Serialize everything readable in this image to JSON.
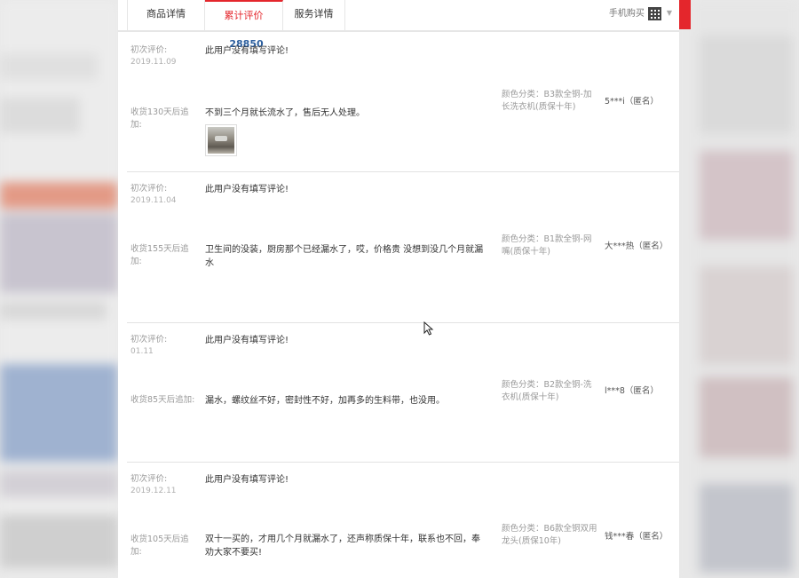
{
  "tabs": [
    {
      "label": "商品详情"
    },
    {
      "label": "累计评价",
      "count": "28850"
    },
    {
      "label": "服务详情"
    }
  ],
  "header": {
    "mobile_buy": "手机购买"
  },
  "reviews": [
    {
      "initial_label": "初次评价:",
      "initial_date": "2019.11.09",
      "initial_text": "此用户没有填写评论!",
      "followup_label": "收货130天后追加:",
      "followup_text": "不到三个月就长流水了，售后无人处理。",
      "sku": "颜色分类：B3款全铜-加长洗衣机(质保十年)",
      "user": "5***i（匿名）"
    },
    {
      "initial_label": "初次评价:",
      "initial_date": "2019.11.04",
      "initial_text": "此用户没有填写评论!",
      "followup_label": "收货155天后追加:",
      "followup_text": "卫生间的没装，厨房那个已经漏水了，哎，价格贵 没想到没几个月就漏水",
      "sku": "颜色分类：B1款全铜-网嘴(质保十年)",
      "user": "大***热（匿名）"
    },
    {
      "initial_label": "初次评价:",
      "initial_date": "01.11",
      "initial_text": "此用户没有填写评论!",
      "followup_label": "收货85天后追加:",
      "followup_text": "漏水，螺纹丝不好，密封性不好，加再多的生料带，也没用。",
      "sku": "颜色分类：B2款全铜-洗衣机(质保十年)",
      "user": "l***8（匿名）"
    },
    {
      "initial_label": "初次评价:",
      "initial_date": "2019.12.11",
      "initial_text": "此用户没有填写评论!",
      "followup_label": "收货105天后追加:",
      "followup_text": "双十一买的，才用几个月就漏水了，还声称质保十年，联系也不回，奉劝大家不要买!",
      "sku": "颜色分类：B6款全铜双用龙头(质保10年)",
      "user": "钱***春（匿名）"
    }
  ],
  "colors": {
    "accent": "#e4262c",
    "count": "#2b5e9e"
  },
  "icons": [
    "qr-code-icon",
    "chevron-down-icon",
    "mouse-cursor-icon",
    "review-photo-thumbnail"
  ]
}
